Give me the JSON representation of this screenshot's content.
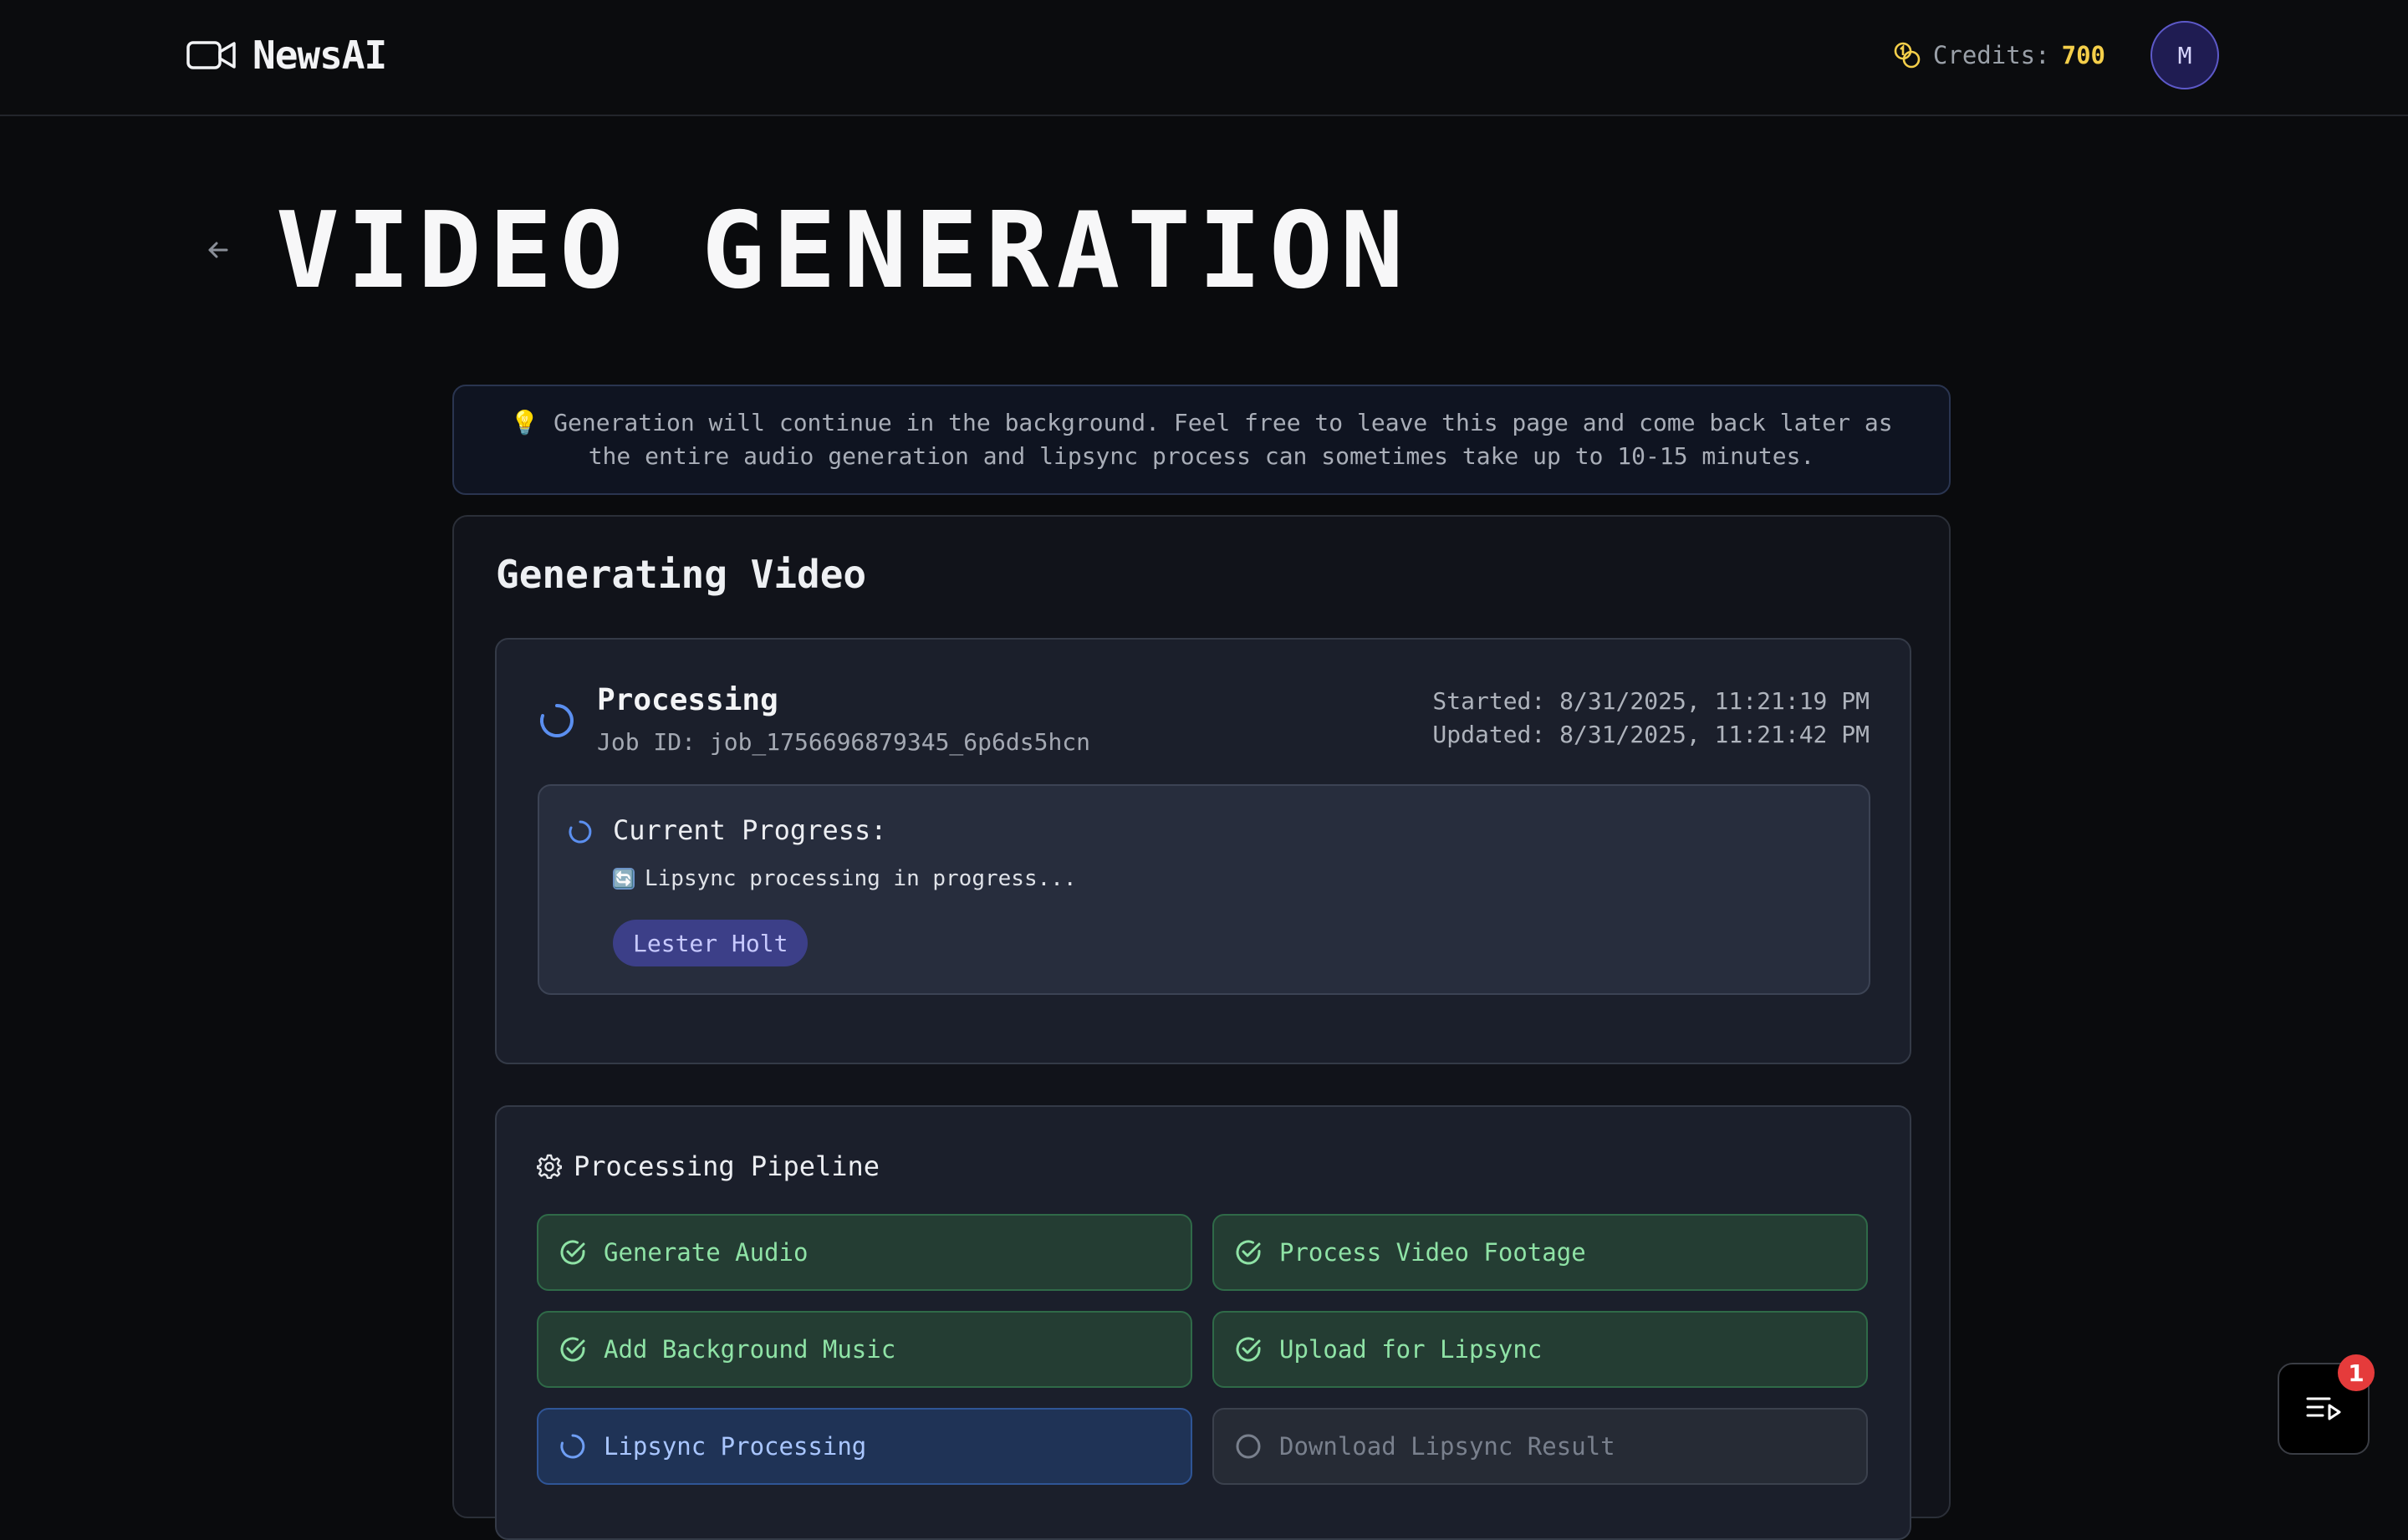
{
  "header": {
    "brand": "NewsAI",
    "credits_label": "Credits:",
    "credits_value": "700",
    "avatar_initial": "M",
    "brand_icon": "video-camera-icon",
    "credits_icon": "coins-icon"
  },
  "page": {
    "title": "VIDEO GENERATION",
    "back_icon": "arrow-left-icon"
  },
  "notice": {
    "emoji": "💡",
    "text": "Generation will continue in the background. Feel free to leave this page and come back later as the entire audio generation and lipsync process can sometimes take up to 10-15 minutes."
  },
  "main": {
    "title": "Generating Video",
    "status": {
      "title": "Processing",
      "job_id": "Job ID: job_1756696879345_6p6ds5hcn",
      "started": "Started: 8/31/2025, 11:21:19 PM",
      "updated": "Updated: 8/31/2025, 11:21:42 PM"
    },
    "progress": {
      "label": "Current Progress:",
      "emoji": "🔄",
      "message": "Lipsync processing in progress...",
      "presenter": "Lester Holt"
    },
    "pipeline": {
      "title": "Processing Pipeline",
      "steps": [
        {
          "label": "Generate Audio",
          "state": "done"
        },
        {
          "label": "Process Video Footage",
          "state": "done"
        },
        {
          "label": "Add Background Music",
          "state": "done"
        },
        {
          "label": "Upload for Lipsync",
          "state": "done"
        },
        {
          "label": "Lipsync Processing",
          "state": "active"
        },
        {
          "label": "Download Lipsync Result",
          "state": "pending"
        }
      ]
    }
  },
  "floating": {
    "badge": "1",
    "icon": "playlist-icon"
  },
  "colors": {
    "background": "#0a0b0d",
    "accent_credits": "#f5cf4a",
    "done_text": "#8fe3a6",
    "active_text": "#a9c6ff",
    "spinner": "#5b8ff0",
    "badge": "#e53b3b"
  }
}
